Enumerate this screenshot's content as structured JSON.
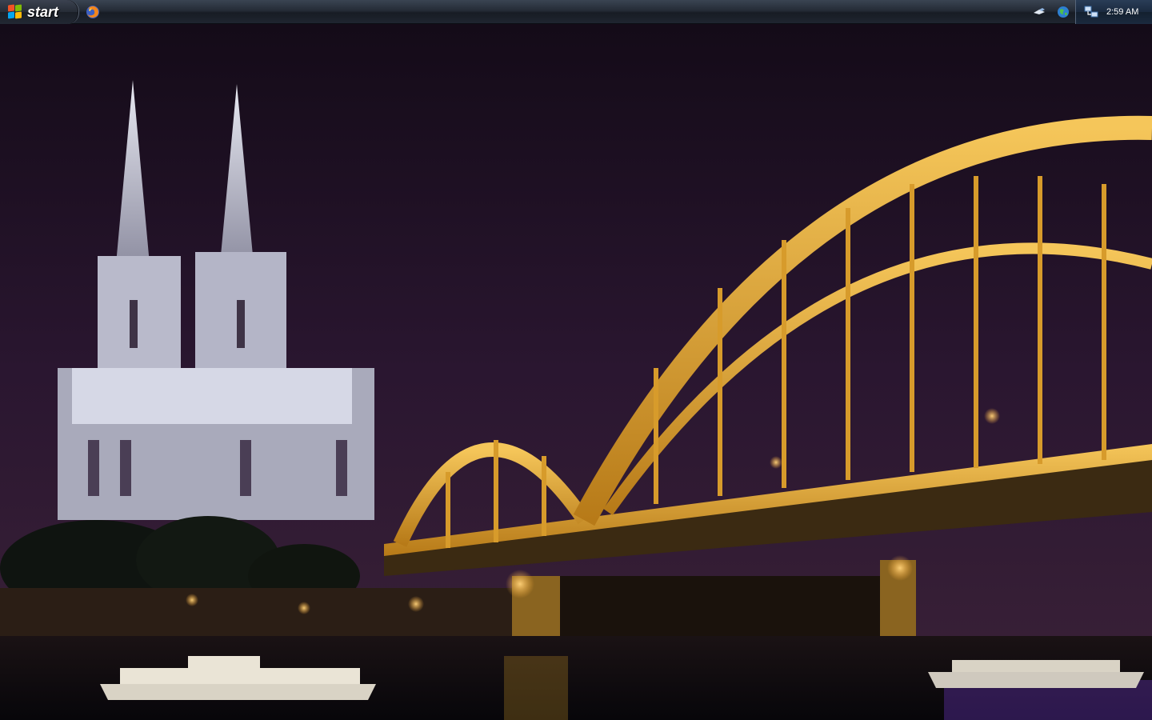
{
  "taskbar": {
    "start_label": "start",
    "quicklaunch": [
      {
        "name": "firefox-icon",
        "tooltip": ""
      }
    ],
    "tray_icons": [
      "network-icon",
      "globe-icon"
    ],
    "clock": {
      "icon": "network-connection-icon",
      "time": "2:59 AM"
    }
  },
  "desktop": {
    "wallpaper": "cologne-cathedral-hohenzollern-bridge-night",
    "colors": {
      "sky": "#2a1630",
      "bridge_gold": "#e0a830",
      "cathedral": "#c8c9d8",
      "water": "#0c0a10"
    }
  }
}
